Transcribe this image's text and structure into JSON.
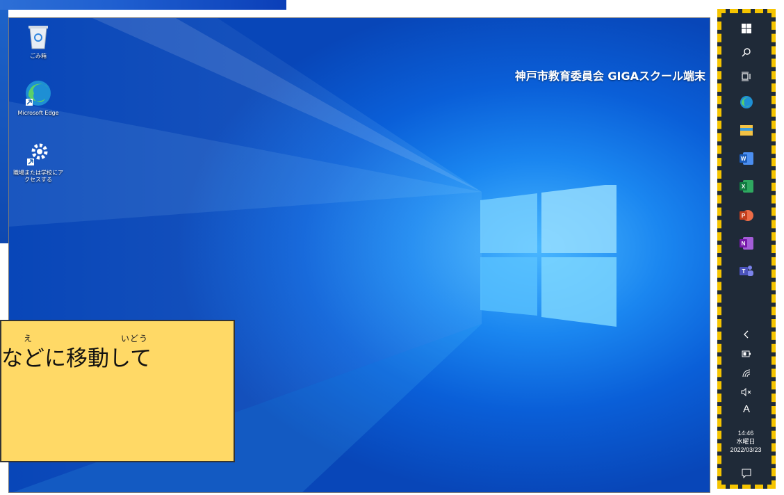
{
  "desktop": {
    "icons": [
      {
        "label": "ごみ箱",
        "icon": "recycle-bin-icon"
      },
      {
        "label": "Microsoft Edge",
        "icon": "edge-icon"
      },
      {
        "label_line1": "職場または学校にア",
        "label_line2": "クセスする",
        "icon": "settings-gear-icon"
      }
    ],
    "title_text": "神戸市教育委員会 GIGAスクール端末"
  },
  "callout": {
    "ruby_e": "え",
    "ruby_idou": "いどう",
    "text": "などに移動して",
    "background": "#ffd966"
  },
  "taskbar": {
    "orientation": "vertical-right",
    "highlight_color": "#f5c400",
    "items": [
      "start-icon",
      "search-icon",
      "task-view-icon",
      "edge-icon",
      "file-explorer-icon",
      "word-icon",
      "excel-icon",
      "powerpoint-icon",
      "onenote-icon",
      "teams-icon"
    ],
    "tray": {
      "chevron": "show-hidden-icons",
      "battery": "battery-icon",
      "network": "wifi-icon",
      "volume": "volume-muted-icon",
      "ime_mode": "A",
      "time": "14:46",
      "weekday": "水曜日",
      "date": "2022/03/23",
      "notifications": "action-center-icon"
    }
  }
}
